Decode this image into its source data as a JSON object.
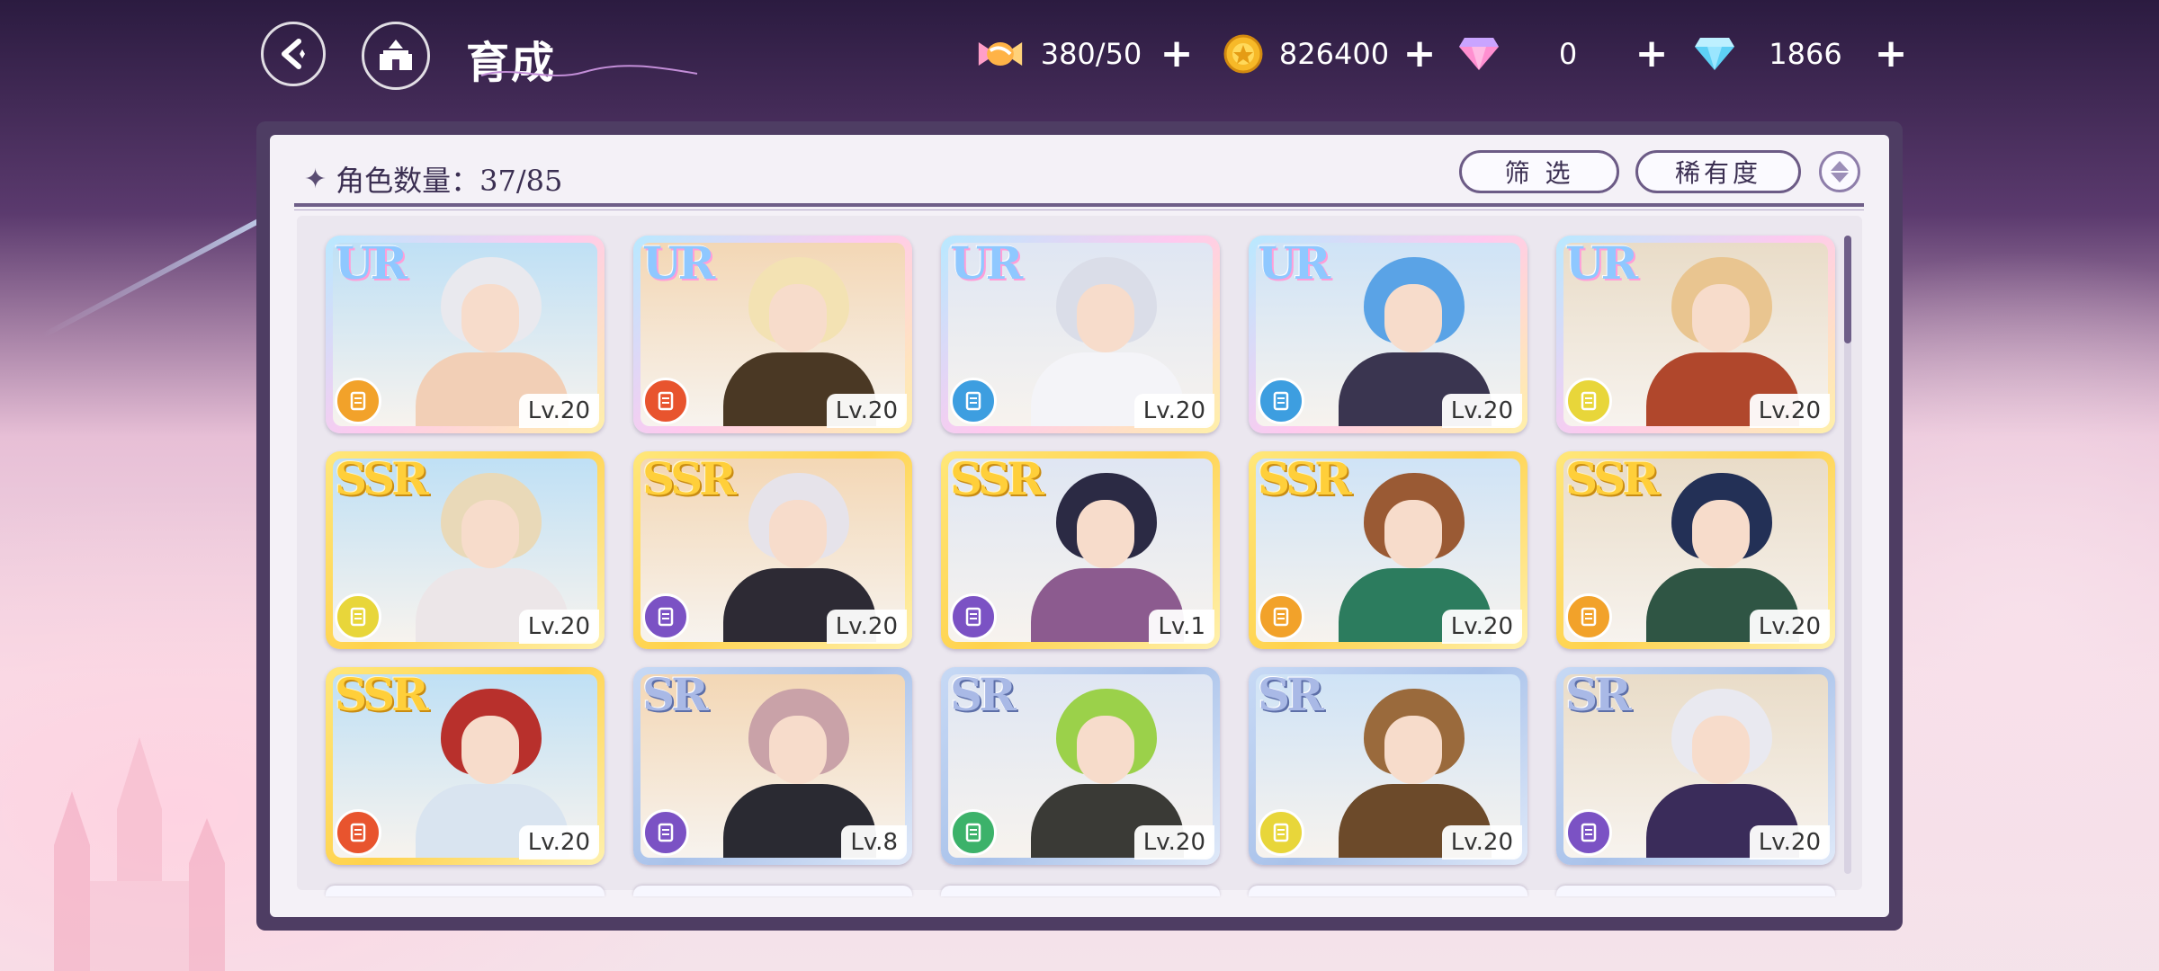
{
  "header": {
    "title": "育成"
  },
  "currencies": [
    {
      "icon": "candy-icon",
      "value": "380/50"
    },
    {
      "icon": "gold-coin-icon",
      "value": "826400"
    },
    {
      "icon": "pink-gem-icon",
      "value": "0"
    },
    {
      "icon": "blue-diamond-icon",
      "value": "1866"
    }
  ],
  "toolbar": {
    "count_label": "角色数量：37/85",
    "filter_label": "筛 选",
    "sort_label": "稀有度"
  },
  "cards": [
    {
      "rarity": "UR",
      "level": "Lv.20",
      "element": "orange"
    },
    {
      "rarity": "UR",
      "level": "Lv.20",
      "element": "red"
    },
    {
      "rarity": "UR",
      "level": "Lv.20",
      "element": "blue"
    },
    {
      "rarity": "UR",
      "level": "Lv.20",
      "element": "blue"
    },
    {
      "rarity": "UR",
      "level": "Lv.20",
      "element": "yellow"
    },
    {
      "rarity": "SSR",
      "level": "Lv.20",
      "element": "yellow"
    },
    {
      "rarity": "SSR",
      "level": "Lv.20",
      "element": "purple"
    },
    {
      "rarity": "SSR",
      "level": "Lv.1",
      "element": "purple"
    },
    {
      "rarity": "SSR",
      "level": "Lv.20",
      "element": "orange"
    },
    {
      "rarity": "SSR",
      "level": "Lv.20",
      "element": "orange"
    },
    {
      "rarity": "SSR",
      "level": "Lv.20",
      "element": "red"
    },
    {
      "rarity": "SR",
      "level": "Lv.8",
      "element": "purple"
    },
    {
      "rarity": "SR",
      "level": "Lv.20",
      "element": "green"
    },
    {
      "rarity": "SR",
      "level": "Lv.20",
      "element": "yellow"
    },
    {
      "rarity": "SR",
      "level": "Lv.20",
      "element": "purple"
    }
  ]
}
